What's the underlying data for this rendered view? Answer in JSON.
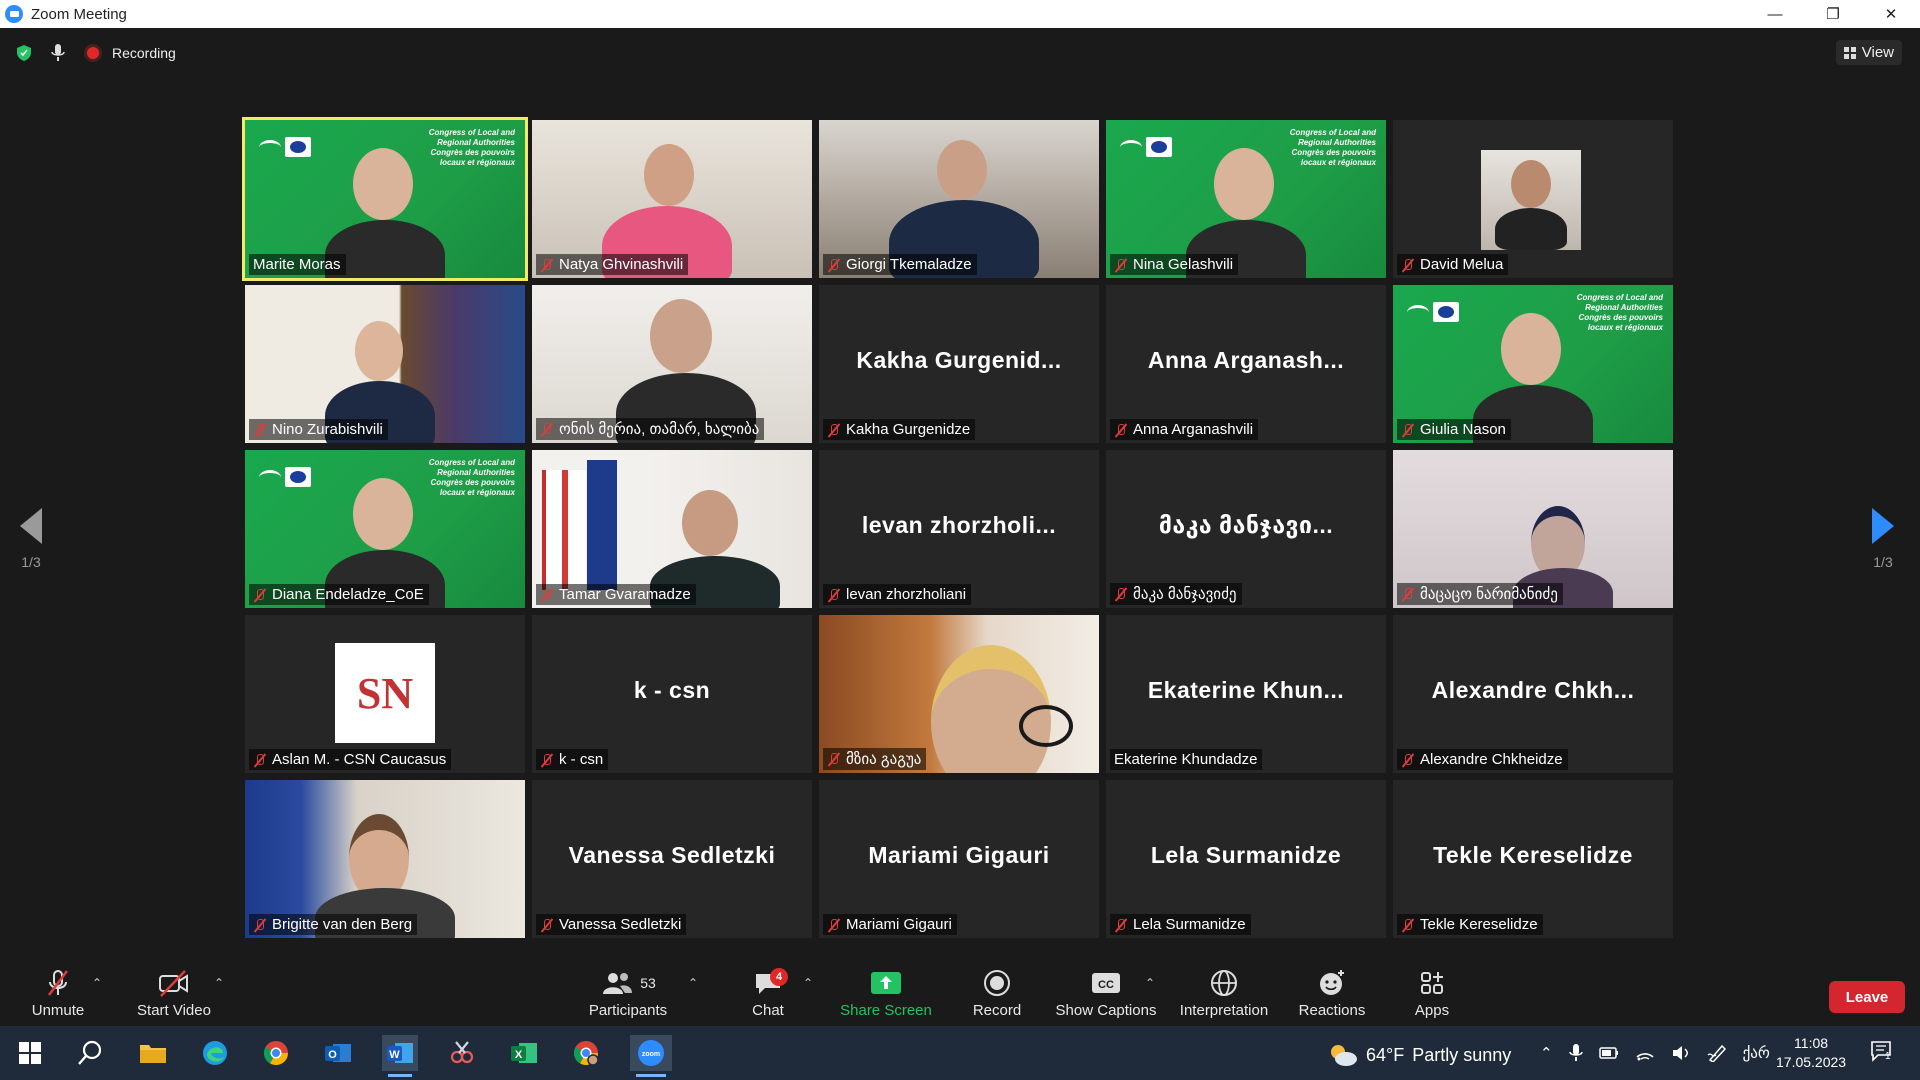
{
  "window": {
    "title": "Zoom Meeting",
    "buttons": [
      "—",
      "❐",
      "✕"
    ]
  },
  "status": {
    "recording_label": "Recording",
    "view_label": "View"
  },
  "pager": {
    "left": "1/3",
    "right": "1/3"
  },
  "tiles": [
    {
      "label": "Marite Moras",
      "type": "video-green",
      "active": true,
      "muted": false
    },
    {
      "label": "Natya Ghvinashvili",
      "type": "video-office",
      "muted": true
    },
    {
      "label": "Giorgi Tkemaladze",
      "type": "video-room",
      "muted": true
    },
    {
      "label": "Nina Gelashvili",
      "type": "video-green",
      "muted": true
    },
    {
      "label": "David Melua",
      "type": "photo",
      "muted": true
    },
    {
      "label": "Nino Zurabishvili",
      "type": "video-shelf",
      "muted": true
    },
    {
      "label": "ონის მერია, თამარ, ხალიბა",
      "type": "video-plain",
      "muted": true
    },
    {
      "label": "Kakha Gurgenidze",
      "display": "Kakha  Gurgenid...",
      "type": "name",
      "muted": true
    },
    {
      "label": "Anna Arganashvili",
      "display": "Anna  Arganash...",
      "type": "name",
      "muted": true
    },
    {
      "label": "Giulia Nason",
      "type": "video-green",
      "muted": true
    },
    {
      "label": "Diana Endeladze_CoE",
      "type": "video-green",
      "muted": true
    },
    {
      "label": "Tamar Gvaramadze",
      "type": "video-flags",
      "muted": true
    },
    {
      "label": "levan zhorzholiani",
      "display": "levan  zhorzholi...",
      "type": "name",
      "muted": true
    },
    {
      "label": "მაკა მანჯავიძე",
      "display": "მაკა  მანჯავი...",
      "type": "name",
      "muted": true
    },
    {
      "label": "მაცაცო ნარიმანიძე",
      "type": "video-wall",
      "muted": true
    },
    {
      "label": "Aslan M. - CSN Caucasus",
      "type": "logo",
      "logo_text": "SN",
      "muted": true
    },
    {
      "label": "k - csn",
      "display": "k - csn",
      "type": "name",
      "muted": true
    },
    {
      "label": "მზია გაგუა",
      "type": "video-wood",
      "muted": true
    },
    {
      "label": "Ekaterine Khundadze",
      "display": "Ekaterine  Khun...",
      "type": "name",
      "muted": false
    },
    {
      "label": "Alexandre Chkheidze",
      "display": "Alexandre  Chkh...",
      "type": "name",
      "muted": true
    },
    {
      "label": "Brigitte van den Berg",
      "type": "video-eu",
      "muted": true
    },
    {
      "label": "Vanessa Sedletzki",
      "display": "Vanessa Sedletzki",
      "type": "name",
      "muted": true
    },
    {
      "label": "Mariami Gigauri",
      "display": "Mariami Gigauri",
      "type": "name",
      "muted": true
    },
    {
      "label": "Lela Surmanidze",
      "display": "Lela Surmanidze",
      "type": "name",
      "muted": true
    },
    {
      "label": "Tekle Kereselidze",
      "display": "Tekle Kereselidze",
      "type": "name",
      "muted": true
    }
  ],
  "congress_text": [
    "Congress of Local and",
    "Regional Authorities",
    "Congrès des pouvoirs",
    "locaux et régionaux"
  ],
  "toolbar": {
    "unmute": "Unmute",
    "start_video": "Start Video",
    "participants": "Participants",
    "participants_count": "53",
    "chat": "Chat",
    "chat_badge": "4",
    "share_screen": "Share Screen",
    "record": "Record",
    "show_captions": "Show Captions",
    "interpretation": "Interpretation",
    "reactions": "Reactions",
    "apps": "Apps",
    "leave": "Leave"
  },
  "taskbar": {
    "weather_temp": "64°F",
    "weather_text": "Partly sunny",
    "lang": "ქარ",
    "time": "11:08",
    "date": "17.05.2023",
    "notif_count": "1"
  },
  "colors": {
    "accent": "#2d8cff",
    "active_border": "#f5e96a",
    "green_bg": "#1aa84e",
    "leave": "#d3262f",
    "share": "#24c262"
  }
}
